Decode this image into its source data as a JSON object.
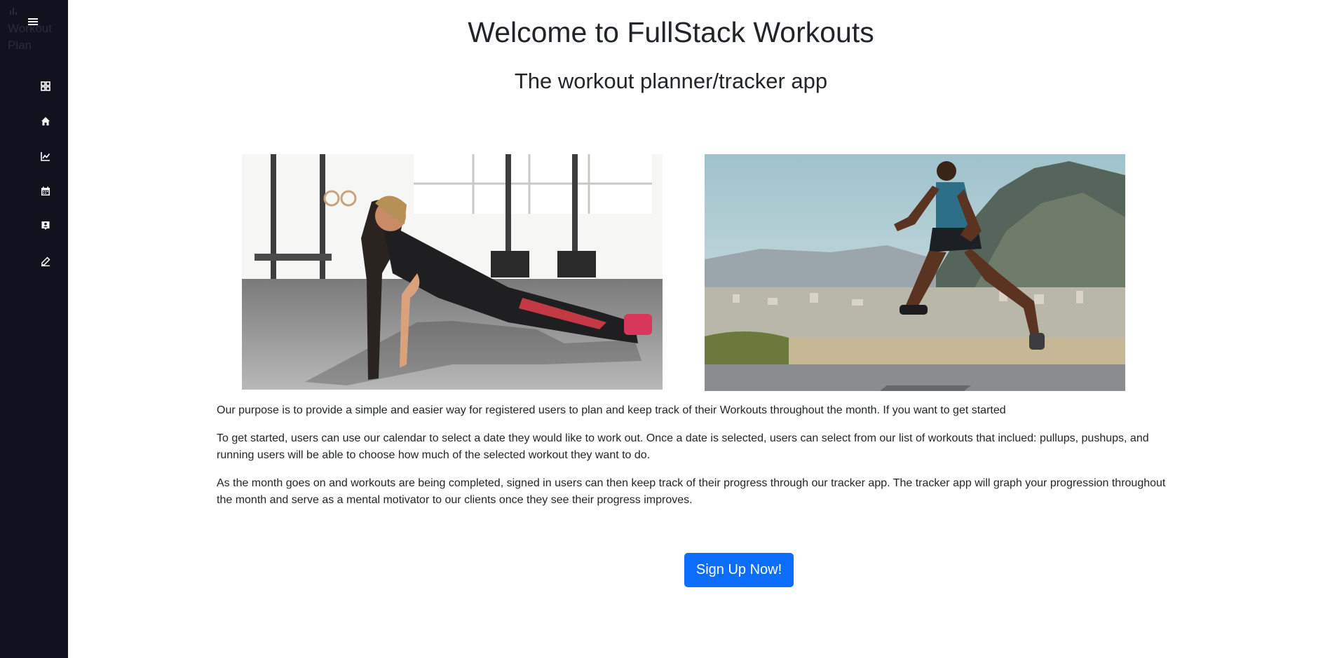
{
  "sidebar": {
    "brand": "Workout Plan",
    "icons": {
      "brand": "bar-chart-icon",
      "toggle": "hamburger-menu-icon"
    },
    "nav": [
      {
        "icon": "dashboard-grid-icon"
      },
      {
        "icon": "home-icon"
      },
      {
        "icon": "line-chart-icon"
      },
      {
        "icon": "calendar-icon"
      },
      {
        "icon": "person-badge-icon"
      },
      {
        "icon": "pencil-edit-icon"
      }
    ],
    "background": "#12121f"
  },
  "main": {
    "title": "Welcome to FullStack Workouts",
    "subtitle": "The workout planner/tracker app",
    "images": {
      "left": "woman doing push-up in gym",
      "right": "man running on mountain road"
    },
    "paragraphs": [
      "Our purpose is to provide a simple and easier way for registered users to plan and keep track of their Workouts throughout the month. If you want to get started",
      "To get started, users can use our calendar to select a date they would like to work out. Once a date is selected, users can select from our list of workouts that inclued: pullups, pushups, and running users will be able to choose how much of the selected workout they want to do.",
      "As the month goes on and workouts are being completed, signed in users can then keep track of their progress through our tracker app. The tracker app will graph your progression throughout the month and serve as a mental motivator to our clients once they see their progress improves."
    ],
    "signup_label": "Sign Up Now!"
  },
  "colors": {
    "accent": "#0d6efd",
    "text": "#212529",
    "sidebar": "#12121f"
  }
}
